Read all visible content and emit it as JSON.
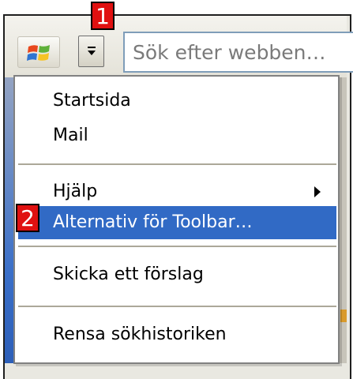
{
  "badges": {
    "step1": "1",
    "step2": "2"
  },
  "toolbar": {
    "logo_icon": "windows-flag-icon",
    "dropdown_icon": "chevron-down-icon",
    "search_placeholder": "Sök efter webben…"
  },
  "menu": {
    "items": [
      {
        "label": "Startsida"
      },
      {
        "label": "Mail"
      },
      {
        "label": "Hjälp",
        "submenu": true
      },
      {
        "label": "Alternativ för Toolbar…",
        "highlighted": true
      },
      {
        "label": "Skicka ett förslag"
      },
      {
        "label": "Rensa sökhistoriken"
      }
    ]
  },
  "colors": {
    "highlight": "#316ac5",
    "badge": "#e01010",
    "search_border": "#7f9db9"
  }
}
